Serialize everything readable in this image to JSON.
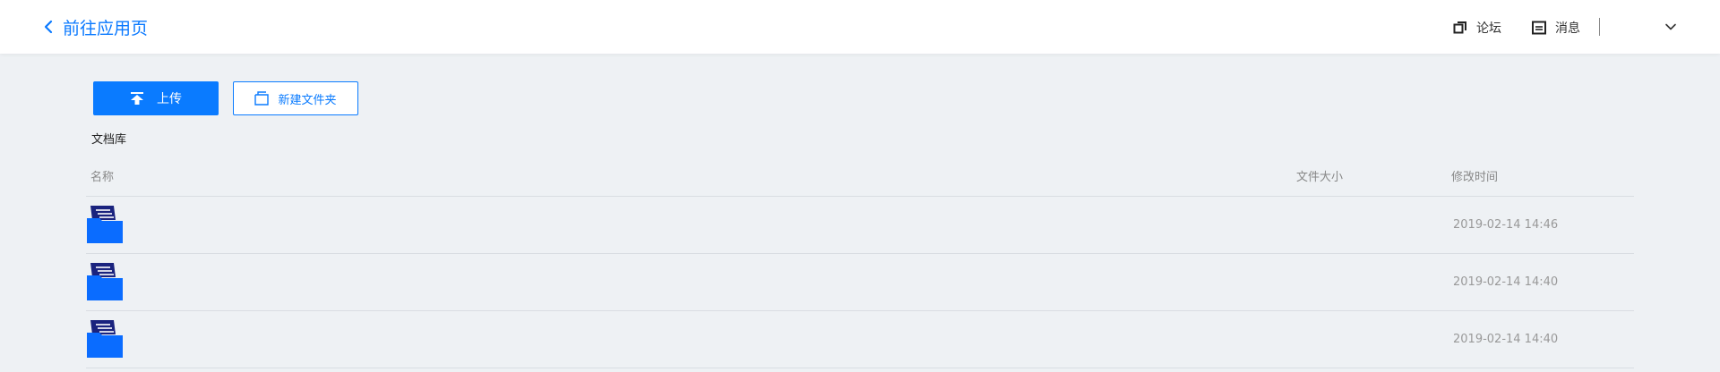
{
  "header": {
    "back_label": "前往应用页",
    "forum_label": "论坛",
    "messages_label": "消息"
  },
  "toolbar": {
    "upload_label": "上传",
    "new_folder_label": "新建文件夹"
  },
  "library": {
    "title": "文档库",
    "columns": {
      "name": "名称",
      "size": "文件大小",
      "modified": "修改时间"
    },
    "rows": [
      {
        "name": "",
        "size": "",
        "modified": "2019-02-14 14:46",
        "icon": "folder-icon"
      },
      {
        "name": "",
        "size": "",
        "modified": "2019-02-14 14:40",
        "icon": "folder-icon"
      },
      {
        "name": "",
        "size": "",
        "modified": "2019-02-14 14:40",
        "icon": "folder-icon"
      }
    ]
  },
  "colors": {
    "accent": "#0a7bff",
    "folder_front": "#0a6cff",
    "folder_back": "#1a237e",
    "page_bg": "#eef1f4"
  }
}
